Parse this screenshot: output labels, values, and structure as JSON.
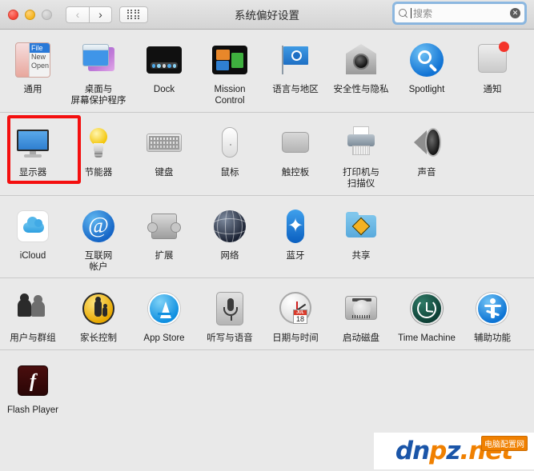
{
  "window": {
    "title": "系统偏好设置",
    "traffic_lights": [
      "close",
      "minimize",
      "zoom-disabled"
    ],
    "nav": {
      "back": "‹",
      "forward": "›",
      "grid": "grid-icon"
    }
  },
  "search": {
    "placeholder": "搜索",
    "value": "",
    "icon": "search-icon",
    "clear": "✕",
    "focused": true
  },
  "highlight": {
    "target": "显示器",
    "color": "#f40f0f"
  },
  "rows": [
    {
      "items": [
        {
          "label": "通用",
          "icon": "general-icon",
          "icon_text": {
            "head": "File",
            "i1": "New",
            "i2": "Open"
          }
        },
        {
          "label": "桌面与\n屏幕保护程序",
          "icon": "desktop-screensaver-icon"
        },
        {
          "label": "Dock",
          "icon": "dock-icon"
        },
        {
          "label": "Mission\nControl",
          "icon": "mission-control-icon"
        },
        {
          "label": "语言与地区",
          "icon": "language-region-icon"
        },
        {
          "label": "安全性与隐私",
          "icon": "security-privacy-icon"
        },
        {
          "label": "Spotlight",
          "icon": "spotlight-icon"
        },
        {
          "label": "通知",
          "icon": "notifications-icon"
        }
      ]
    },
    {
      "items": [
        {
          "label": "显示器",
          "icon": "displays-icon",
          "highlighted": true
        },
        {
          "label": "节能器",
          "icon": "energy-saver-icon"
        },
        {
          "label": "键盘",
          "icon": "keyboard-icon"
        },
        {
          "label": "鼠标",
          "icon": "mouse-icon"
        },
        {
          "label": "触控板",
          "icon": "trackpad-icon"
        },
        {
          "label": "打印机与\n扫描仪",
          "icon": "printers-scanners-icon"
        },
        {
          "label": "声音",
          "icon": "sound-icon"
        }
      ]
    },
    {
      "items": [
        {
          "label": "iCloud",
          "icon": "icloud-icon"
        },
        {
          "label": "互联网\n帐户",
          "icon": "internet-accounts-icon"
        },
        {
          "label": "扩展",
          "icon": "extensions-icon"
        },
        {
          "label": "网络",
          "icon": "network-icon"
        },
        {
          "label": "蓝牙",
          "icon": "bluetooth-icon"
        },
        {
          "label": "共享",
          "icon": "sharing-icon"
        }
      ]
    },
    {
      "items": [
        {
          "label": "用户与群组",
          "icon": "users-groups-icon"
        },
        {
          "label": "家长控制",
          "icon": "parental-controls-icon"
        },
        {
          "label": "App Store",
          "icon": "app-store-icon"
        },
        {
          "label": "听写与语音",
          "icon": "dictation-speech-icon"
        },
        {
          "label": "日期与时间",
          "icon": "date-time-icon",
          "calendar": {
            "month": "JUL",
            "day": "18"
          }
        },
        {
          "label": "启动磁盘",
          "icon": "startup-disk-icon"
        },
        {
          "label": "Time Machine",
          "icon": "time-machine-icon"
        },
        {
          "label": "辅助功能",
          "icon": "accessibility-icon"
        }
      ]
    },
    {
      "items": [
        {
          "label": "Flash Player",
          "icon": "flash-player-icon",
          "glyph": "f"
        }
      ]
    }
  ],
  "watermark": {
    "text_a": "dn",
    "text_b": "p",
    "text_c": "z",
    "text_d": ".net",
    "badge": "电脑配置网"
  }
}
